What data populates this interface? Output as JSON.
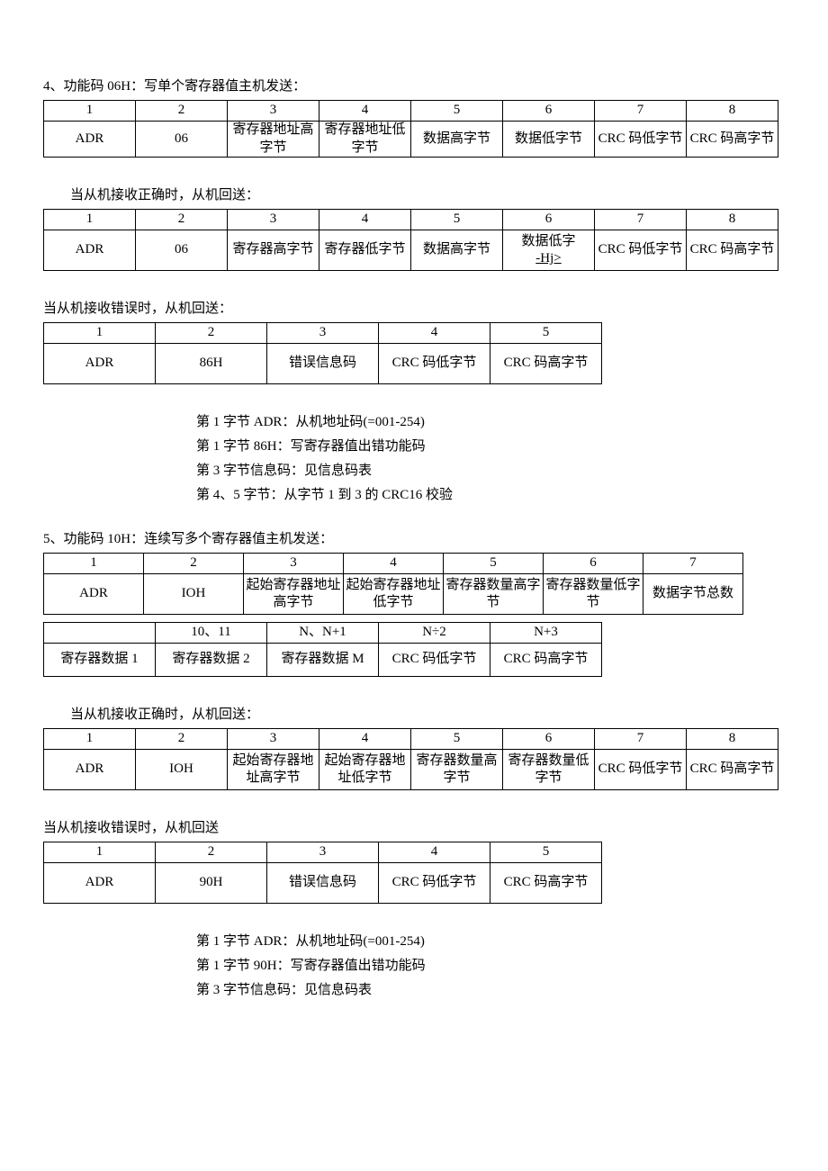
{
  "section4": {
    "title": "4、功能码 06H：写单个寄存器值主机发送：",
    "sendTable": {
      "headers": [
        "1",
        "2",
        "3",
        "4",
        "5",
        "6",
        "7",
        "8"
      ],
      "row": [
        "ADR",
        "06",
        "寄存器地址高字节",
        "寄存器地址低字节",
        "数据高字节",
        "数据低字节",
        "CRC 码低字节",
        "CRC 码高字节"
      ]
    },
    "okTitle": "当从机接收正确时，从机回送：",
    "okTable": {
      "headers": [
        "1",
        "2",
        "3",
        "4",
        "5",
        "6",
        "7",
        "8"
      ],
      "row": [
        "ADR",
        "06",
        "寄存器高字节",
        "寄存器低字节",
        "数据高字节",
        "数据低字",
        "CRC 码低字节",
        "CRC 码高字节"
      ],
      "row6suffix": "-Hj>"
    },
    "errTitle": "当从机接收错误时，从机回送：",
    "errTable": {
      "headers": [
        "1",
        "2",
        "3",
        "4",
        "5"
      ],
      "row": [
        "ADR",
        "86H",
        "错误信息码",
        "CRC 码低字节",
        "CRC 码高字节"
      ]
    },
    "notes": [
      "第 1 字节 ADR：从机地址码(=001-254)",
      "第 1 字节 86H：写寄存器值出错功能码",
      "第 3 字节信息码：见信息码表",
      "第 4、5 字节：从字节 1 到 3 的 CRC16 校验"
    ]
  },
  "section5": {
    "title": "5、功能码 10H：连续写多个寄存器值主机发送：",
    "sendTable1": {
      "headers": [
        "1",
        "2",
        "3",
        "4",
        "5",
        "6",
        "7"
      ],
      "row": [
        "ADR",
        "IOH",
        "起始寄存器地址高字节",
        "起始寄存器地址低字节",
        "寄存器数量高字节",
        "寄存器数量低字节",
        "数据字节总数"
      ]
    },
    "sendTable2": {
      "headers": [
        "",
        "10、11",
        "N、N+1",
        "N÷2",
        "N+3"
      ],
      "row": [
        "寄存器数据 1",
        "寄存器数据 2",
        "寄存器数据 M",
        "CRC 码低字节",
        "CRC 码高字节"
      ]
    },
    "okTitle": "当从机接收正确时，从机回送：",
    "okTable": {
      "headers": [
        "1",
        "2",
        "3",
        "4",
        "5",
        "6",
        "7",
        "8"
      ],
      "row": [
        "ADR",
        "IOH",
        "起始寄存器地址高字节",
        "起始寄存器地址低字节",
        "寄存器数量高字节",
        "寄存器数量低字节",
        "CRC 码低字节",
        "CRC 码高字节"
      ]
    },
    "errTitle": "当从机接收错误时，从机回送",
    "errTable": {
      "headers": [
        "1",
        "2",
        "3",
        "4",
        "5"
      ],
      "row": [
        "ADR",
        "90H",
        "错误信息码",
        "CRC 码低字节",
        "CRC 码高字节"
      ]
    },
    "notes": [
      "第 1 字节 ADR：从机地址码(=001-254)",
      "第 1 字节 90H：写寄存器值出错功能码",
      "第 3 字节信息码：见信息码表"
    ]
  }
}
